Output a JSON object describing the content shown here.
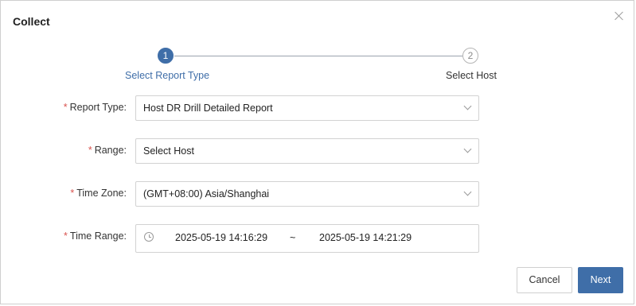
{
  "dialog": {
    "title": "Collect",
    "close_icon": "close-icon"
  },
  "stepper": {
    "steps": [
      {
        "number": "1",
        "label": "Select Report Type",
        "state": "active"
      },
      {
        "number": "2",
        "label": "Select Host",
        "state": "inactive"
      }
    ]
  },
  "form": {
    "required_mark": "*",
    "report_type": {
      "label": "Report Type:",
      "value": "Host DR Drill Detailed Report",
      "icon": "chevron-down-icon"
    },
    "range": {
      "label": "Range:",
      "value": "Select Host",
      "icon": "chevron-down-icon"
    },
    "time_zone": {
      "label": "Time Zone:",
      "value": "(GMT+08:00) Asia/Shanghai",
      "icon": "chevron-down-icon"
    },
    "time_range": {
      "label": "Time Range:",
      "start": "2025-05-19 14:16:29",
      "separator": "~",
      "end": "2025-05-19 14:21:29",
      "icon": "clock-icon"
    }
  },
  "footer": {
    "cancel_label": "Cancel",
    "next_label": "Next"
  },
  "colors": {
    "accent": "#3f6ea8",
    "required": "#d9534f",
    "border": "#d2d2d2"
  }
}
